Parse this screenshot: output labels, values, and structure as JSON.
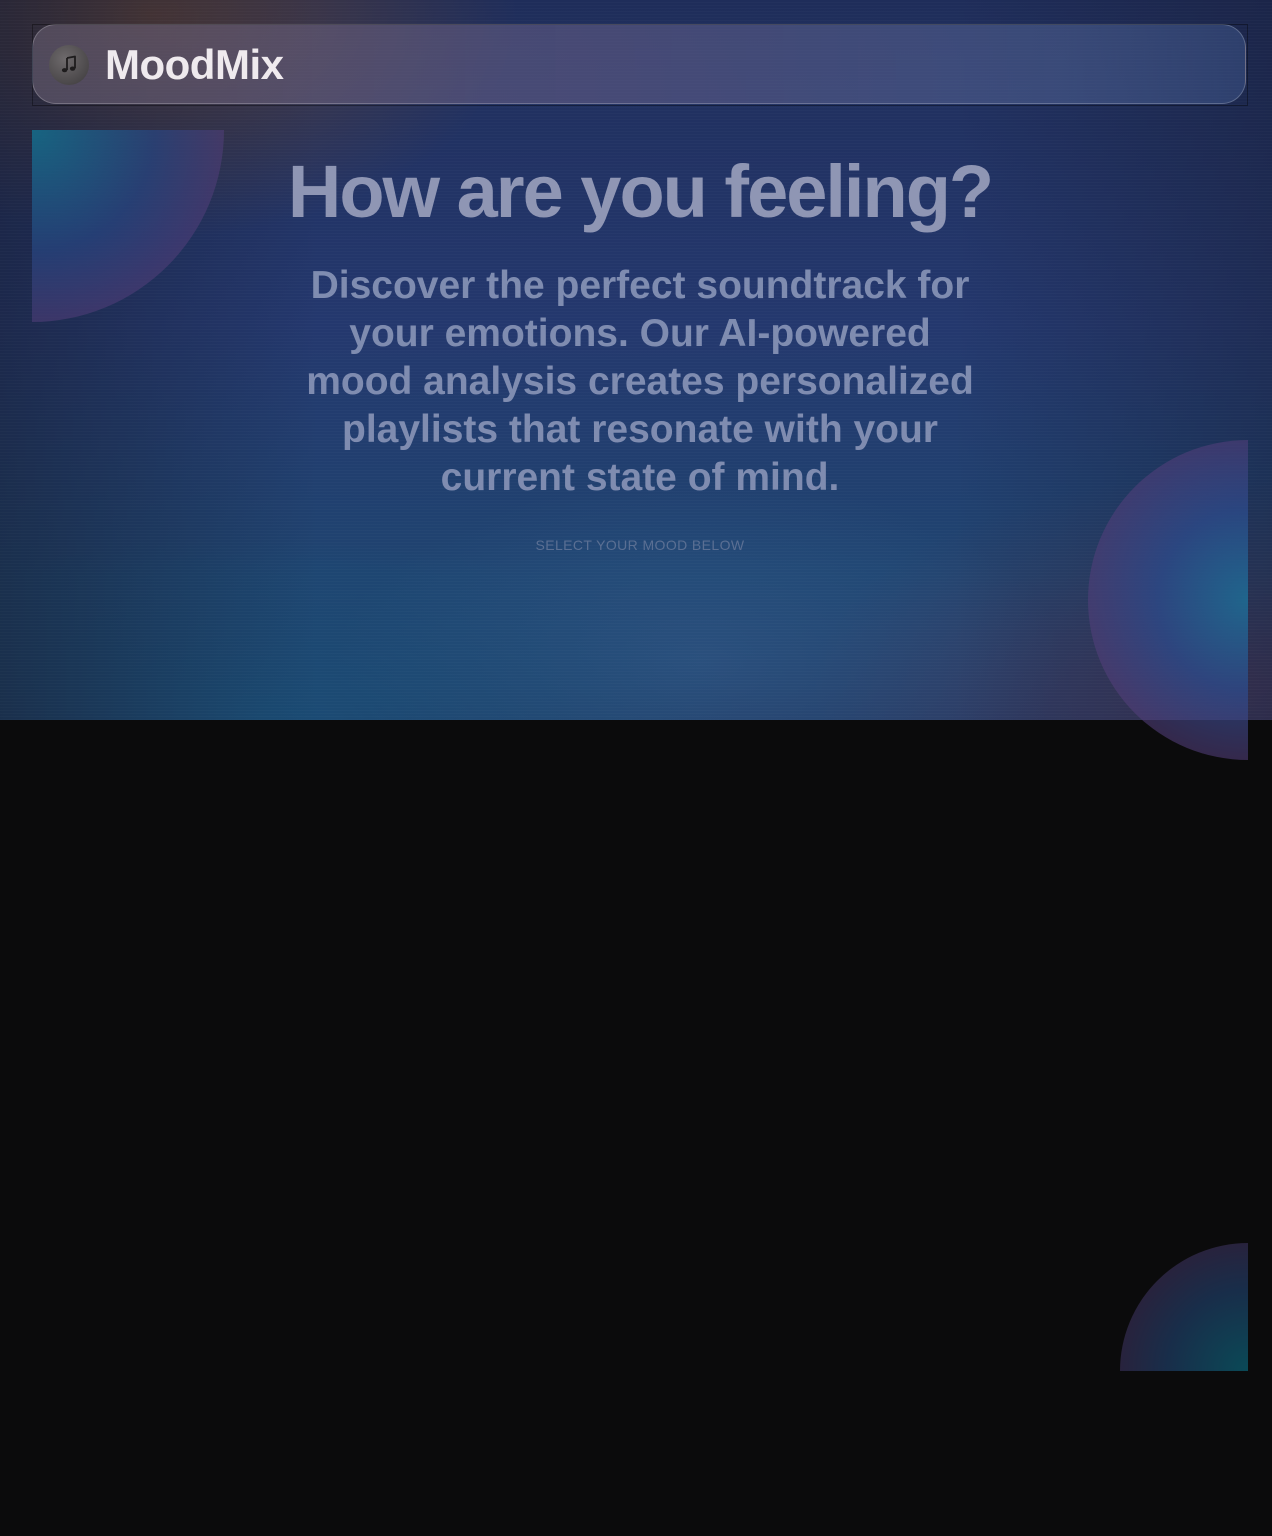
{
  "header": {
    "brand_name": "MoodMix",
    "logo_icon": "music-note-icon"
  },
  "hero": {
    "headline": "How are you feeling?",
    "description": "Discover the perfect soundtrack for your emotions. Our AI-powered mood analysis creates personalized playlists that resonate with your current state of mind.",
    "cta_hint": "SELECT YOUR MOOD BELOW"
  },
  "colors": {
    "page_background": "#0b0b0c",
    "hero_primary": "#24386e",
    "brand_text": "#efeaee",
    "headline_text": "#8f96b4",
    "description_text": "#7f8cb0",
    "hint_text": "#5a6f93"
  }
}
